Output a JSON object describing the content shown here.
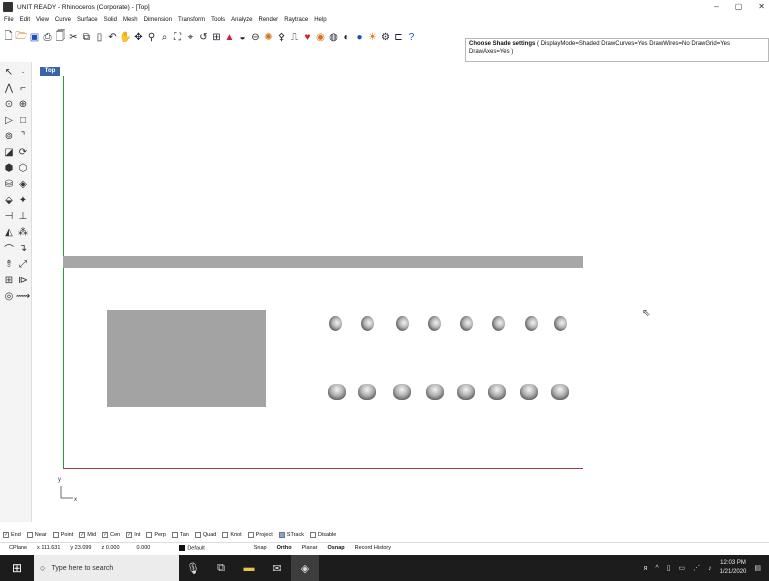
{
  "window": {
    "title": "UNIT READY - Rhinoceros (Corporate) - [Top]",
    "minimize": "–",
    "maximize": "▢",
    "close": "✕"
  },
  "menu": [
    "File",
    "Edit",
    "View",
    "Curve",
    "Surface",
    "Solid",
    "Mesh",
    "Dimension",
    "Transform",
    "Tools",
    "Analyze",
    "Render",
    "Raytrace",
    "Help"
  ],
  "command": {
    "prefix": "Choose Shade settings",
    "line1": " ( DisplayMode=Shaded  DrawCurves=Yes  DrawWires=No  DrawGrid=Yes",
    "line2": "DrawAxes=Yes )"
  },
  "viewport": {
    "name": "Top",
    "axis_y": "y",
    "axis_x": "x"
  },
  "osnap": {
    "items": [
      {
        "label": "End",
        "checked": true
      },
      {
        "label": "Near",
        "checked": false
      },
      {
        "label": "Point",
        "checked": false
      },
      {
        "label": "Mid",
        "checked": true
      },
      {
        "label": "Cen",
        "checked": true
      },
      {
        "label": "Int",
        "checked": true
      },
      {
        "label": "Perp",
        "checked": false
      },
      {
        "label": "Tan",
        "checked": false
      },
      {
        "label": "Quad",
        "checked": false
      },
      {
        "label": "Knot",
        "checked": false
      }
    ],
    "project": "Project",
    "smarttrack": "STrack",
    "disable": "Disable"
  },
  "status": {
    "cplane": "CPlane",
    "x": "x 111.631",
    "y": "y 23.099",
    "z": "z 0.000",
    "distance": "0.000",
    "layer": "Default",
    "snap": "Snap",
    "ortho": "Ortho",
    "planar": "Planar",
    "osnap": "Osnap",
    "record": "Record History"
  },
  "taskbar": {
    "search_placeholder": "Type here to search",
    "time": "12:03 PM",
    "date": "1/21/2020"
  },
  "colors": {
    "viewport_tab": "#3a63a8",
    "y_axis": "#2b9a3d",
    "x_axis": "#a83c3c",
    "taskbar": "#1c1c1c"
  }
}
